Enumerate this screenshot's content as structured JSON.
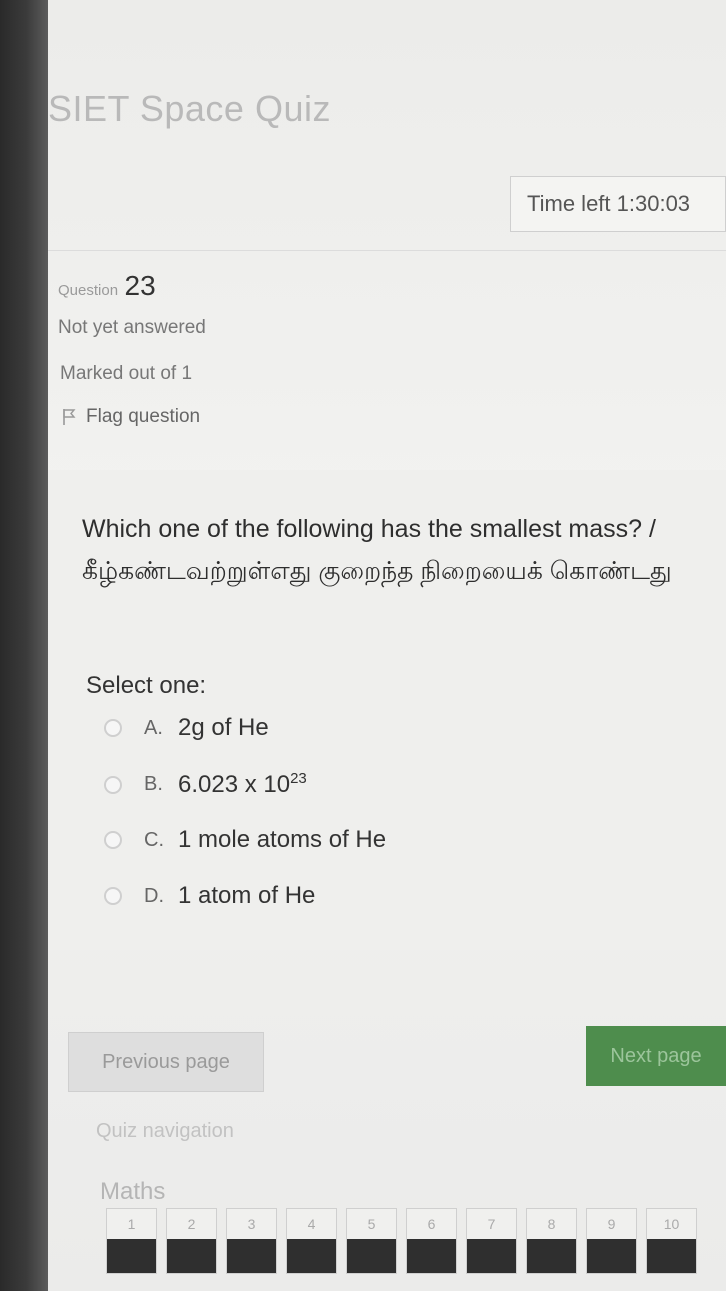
{
  "quiz": {
    "title": "SIET Space Quiz"
  },
  "timer": {
    "text": "Time left 1:30:03"
  },
  "question": {
    "label": "Question",
    "number": "23",
    "status": "Not yet answered",
    "marks": "Marked out of 1",
    "flag_label": "Flag question",
    "text_en": "Which one of the following has the smallest mass? /",
    "text_ta": "கீழ்கண்டவற்றுள்எது குறைந்த நிறையைக் கொண்டது",
    "select_label": "Select one:",
    "options": [
      {
        "letter": "A.",
        "text": "2g of He"
      },
      {
        "letter": "B.",
        "base": "6.023 x 10",
        "exp": "23"
      },
      {
        "letter": "C.",
        "text": "1 mole atoms of He"
      },
      {
        "letter": "D.",
        "text": "1 atom of He"
      }
    ]
  },
  "buttons": {
    "previous": "Previous page",
    "next": "Next page"
  },
  "navigation": {
    "title": "Quiz navigation",
    "section": "Maths",
    "items": [
      "1",
      "2",
      "3",
      "4",
      "5",
      "6",
      "7",
      "8",
      "9",
      "10"
    ]
  }
}
